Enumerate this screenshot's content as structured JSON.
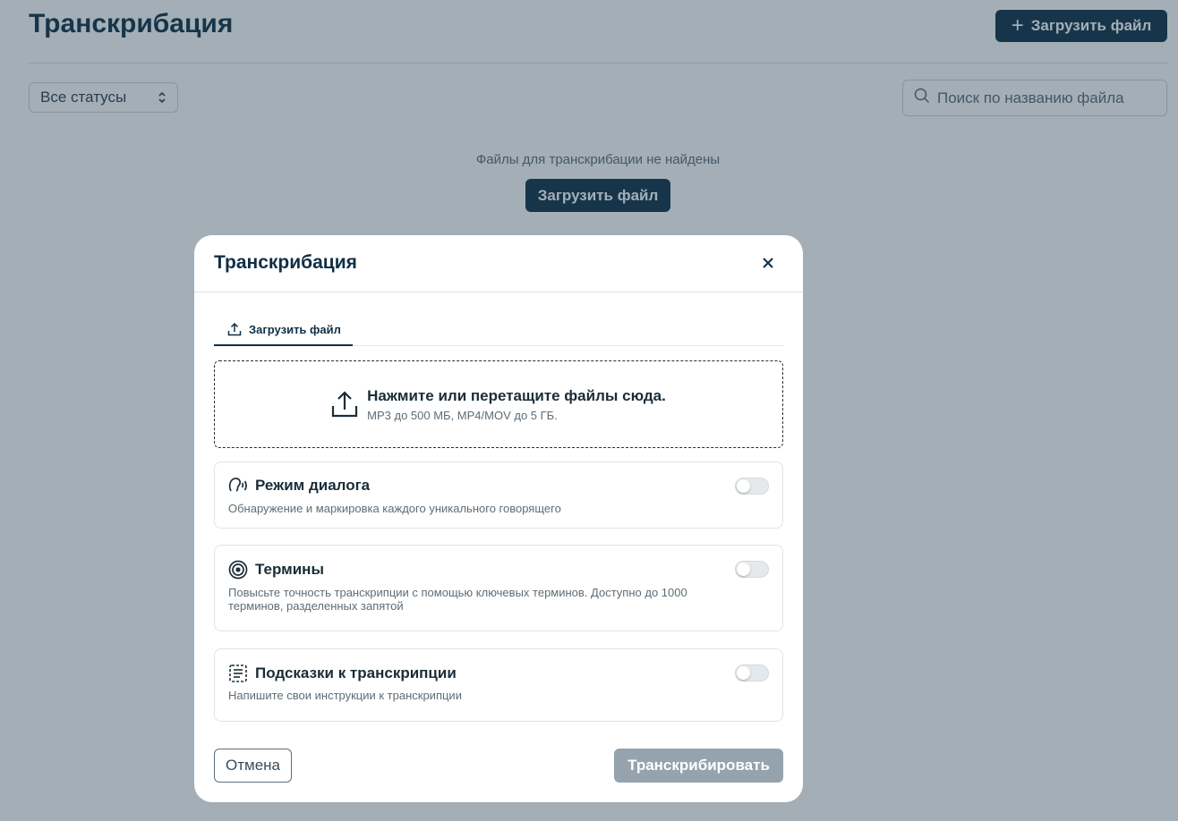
{
  "page": {
    "title": "Транскрибация",
    "upload_button": "Загрузить файл",
    "status_filter": "Все статусы",
    "search_placeholder": "Поиск по названию файла",
    "empty_message": "Файлы для транскрибации не найдены",
    "empty_upload_button": "Загрузить файл"
  },
  "modal": {
    "title": "Транскрибация",
    "tab_upload": "Загрузить файл",
    "dropzone": {
      "title": "Нажмите или перетащите файлы сюда.",
      "subtitle": "MP3 до 500 МБ, MP4/MOV до 5 ГБ."
    },
    "options": [
      {
        "title": "Режим диалога",
        "description": "Обнаружение и маркировка каждого уникального говорящего",
        "icon": "speaker-icon",
        "enabled": false
      },
      {
        "title": "Термины",
        "description": "Повысьте точность транскрипции с помощью ключевых терминов. Доступно до 1000 терминов, разделенных запятой",
        "icon": "target-icon",
        "enabled": false
      },
      {
        "title": "Подсказки к транскрипции",
        "description": "Напишите свои инструкции к транскрипции",
        "icon": "notes-icon",
        "enabled": false
      }
    ],
    "cancel_button": "Отмена",
    "submit_button": "Транскрибировать"
  },
  "colors": {
    "primary": "#0f2f45",
    "disabled_button": "#94a3ad",
    "overlay": "rgba(36,62,82,0.42)"
  }
}
